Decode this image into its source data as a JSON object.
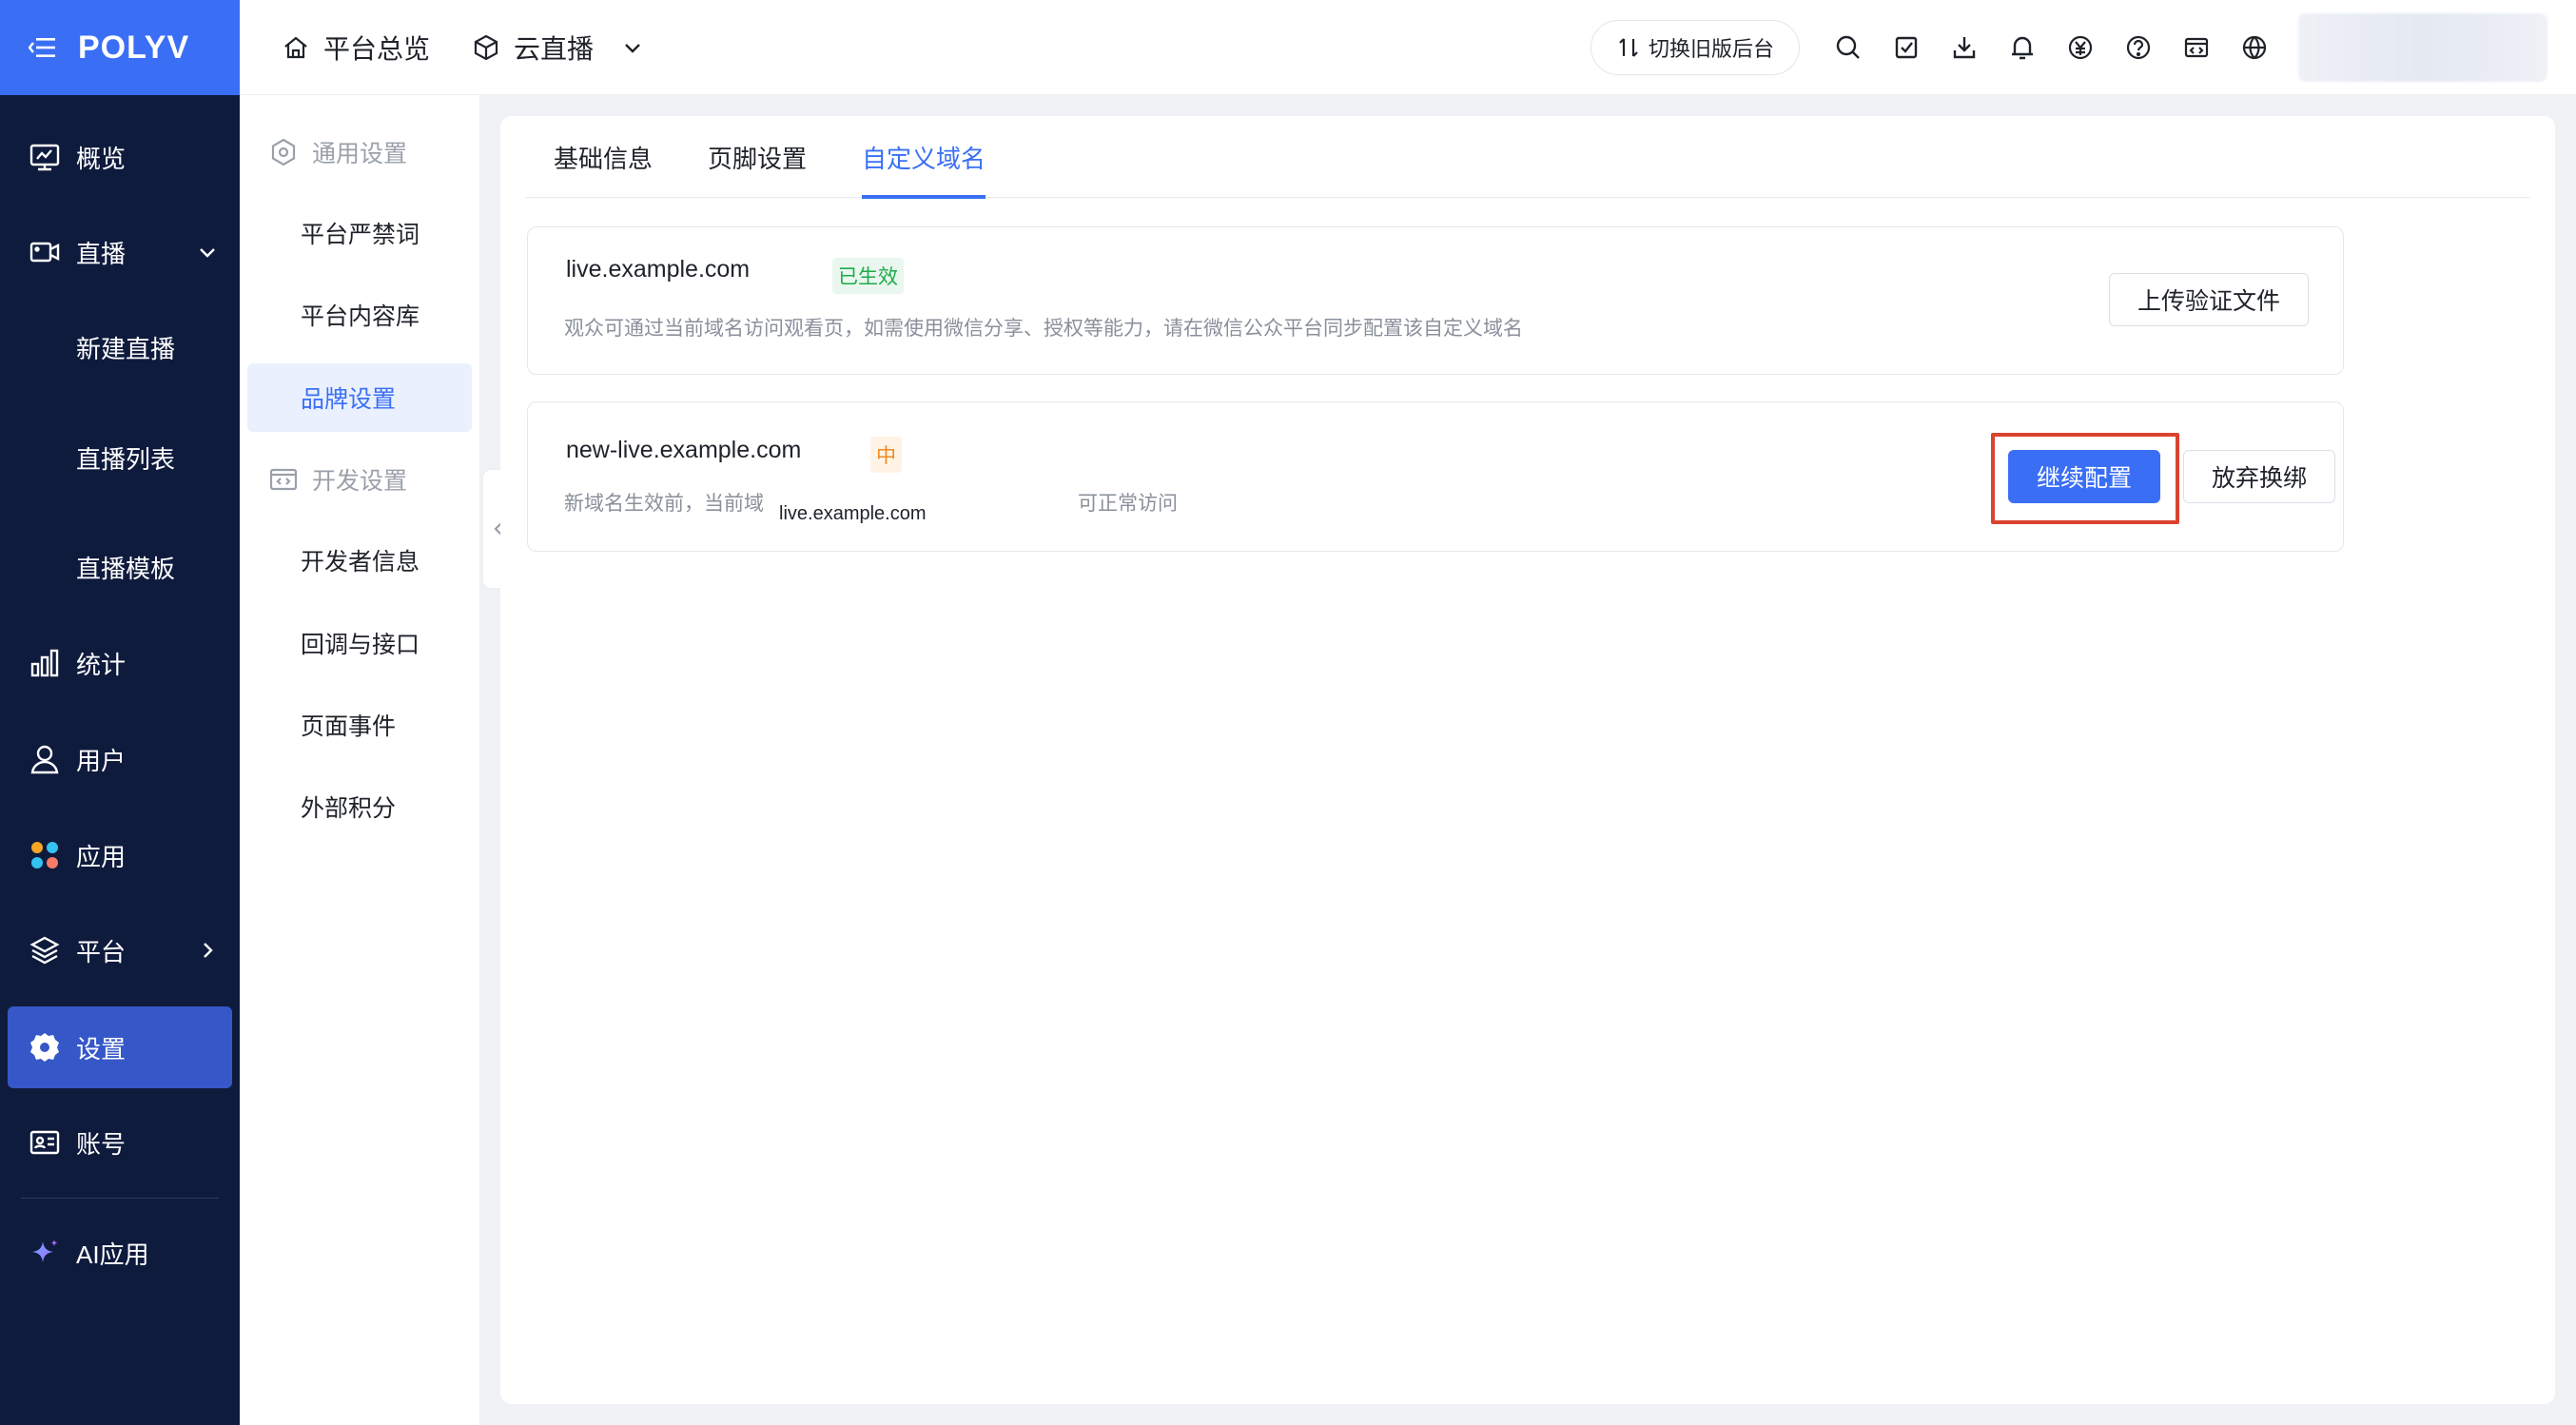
{
  "sidebar": {
    "logo": "POLYV",
    "items": [
      {
        "label": "概览"
      },
      {
        "label": "直播"
      },
      {
        "label": "新建直播"
      },
      {
        "label": "直播列表"
      },
      {
        "label": "直播模板"
      },
      {
        "label": "统计"
      },
      {
        "label": "用户"
      },
      {
        "label": "应用"
      },
      {
        "label": "平台"
      },
      {
        "label": "设置"
      },
      {
        "label": "账号"
      },
      {
        "label": "AI应用"
      }
    ],
    "active_item": "设置"
  },
  "header": {
    "crumbs": [
      {
        "label": "平台总览",
        "icon": "home-icon"
      },
      {
        "label": "云直播",
        "icon": "cube-icon"
      }
    ],
    "switch_label": "切换旧版后台",
    "icons": [
      "search-icon",
      "task-icon",
      "download-icon",
      "bell-icon",
      "yuan-icon",
      "help-icon",
      "code-window-icon",
      "globe-icon"
    ]
  },
  "subnav": {
    "groups": [
      {
        "label": "通用设置",
        "items": [
          {
            "label": "平台严禁词"
          },
          {
            "label": "平台内容库"
          },
          {
            "label": "品牌设置"
          }
        ]
      },
      {
        "label": "开发设置",
        "items": [
          {
            "label": "开发者信息"
          },
          {
            "label": "回调与接口"
          },
          {
            "label": "页面事件"
          },
          {
            "label": "外部积分"
          }
        ]
      }
    ],
    "active_item": "品牌设置"
  },
  "tabs": [
    {
      "label": "基础信息"
    },
    {
      "label": "页脚设置"
    },
    {
      "label": "自定义域名"
    }
  ],
  "active_tab": "自定义域名",
  "domains": [
    {
      "domain": "live.example.com",
      "status": "已生效",
      "status_color": "#1faa4c",
      "description": "观众可通过当前域名访问观看页，如需使用微信分享、授权等能力，请在微信公众平台同步配置该自定义域名",
      "action_label": "上传验证文件"
    },
    {
      "domain": "new-live.example.com",
      "status": "中",
      "status_color": "#f08a24",
      "description_left": "新域名生效前，当前域",
      "description_right": "可正常访问",
      "tooltip": "live.example.com",
      "primary_label": "继续配置",
      "secondary_label": "放弃换绑"
    }
  ],
  "colors": {
    "accent": "#3a6ff5",
    "sidebar_bg": "#0f1b3d",
    "highlight": "#d9432f"
  }
}
